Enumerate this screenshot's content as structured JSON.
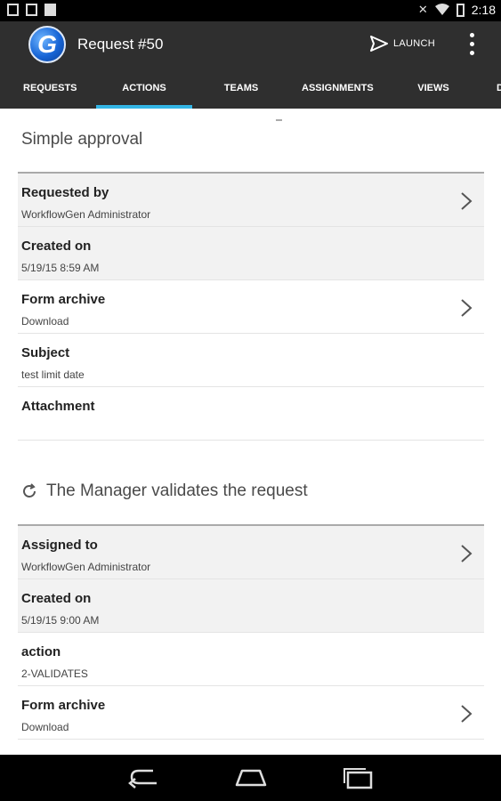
{
  "status_bar": {
    "time": "2:18",
    "left_icons": [
      "image-icon",
      "sd-card-icon",
      "storage-icon"
    ],
    "right_icons": [
      "no-sound-icon",
      "wifi-icon",
      "battery-icon"
    ]
  },
  "app_bar": {
    "logo_letter": "G",
    "title": "Request #50",
    "launch_label": "LAUNCH",
    "accent_color": "#33b5e5"
  },
  "tabs": [
    {
      "label": "REQUESTS"
    },
    {
      "label": "ACTIONS",
      "active": true
    },
    {
      "label": "TEAMS"
    },
    {
      "label": "ASSIGNMENTS"
    },
    {
      "label": "VIEWS"
    },
    {
      "label": "D"
    }
  ],
  "request_section": {
    "title": "Simple approval",
    "rows": [
      {
        "label": "Requested by",
        "value": "WorkflowGen Administrator",
        "chevron": true
      },
      {
        "label": "Created on",
        "value": "5/19/15 8:59 AM",
        "chevron": false
      },
      {
        "label": "Form archive",
        "value": "Download",
        "chevron": true
      },
      {
        "label": "Subject",
        "value": "test limit date",
        "chevron": false
      },
      {
        "label": "Attachment",
        "value": "",
        "chevron": false
      }
    ]
  },
  "action_section": {
    "title": "The Manager validates the request",
    "rows": [
      {
        "label": "Assigned to",
        "value": "WorkflowGen Administrator",
        "chevron": true
      },
      {
        "label": "Created on",
        "value": "5/19/15 9:00 AM",
        "chevron": false
      },
      {
        "label": "action",
        "value": "2-VALIDATES",
        "chevron": false
      },
      {
        "label": "Form archive",
        "value": "Download",
        "chevron": true
      }
    ]
  },
  "nav_bar": {
    "buttons": [
      "back-icon",
      "home-icon",
      "recent-apps-icon"
    ]
  }
}
